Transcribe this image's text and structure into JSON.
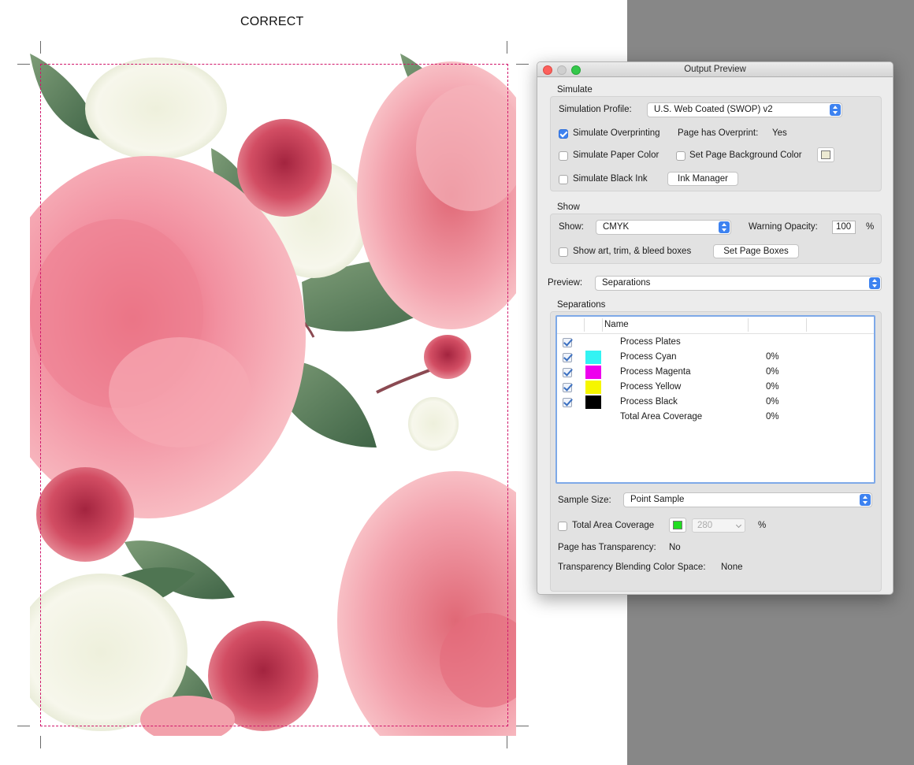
{
  "document": {
    "caption": "CORRECT"
  },
  "dialog": {
    "title": "Output Preview",
    "simulate": {
      "section_label": "Simulate",
      "profile_label": "Simulation Profile:",
      "profile_value": "U.S. Web Coated (SWOP) v2",
      "overprinting_label": "Simulate Overprinting",
      "overprinting_checked": true,
      "page_overprint_label": "Page has Overprint:",
      "page_overprint_value": "Yes",
      "paper_color_label": "Simulate Paper Color",
      "paper_color_checked": false,
      "page_bg_label": "Set Page Background Color",
      "page_bg_checked": false,
      "page_bg_color": "#ece9d2",
      "black_ink_label": "Simulate Black Ink",
      "black_ink_checked": false,
      "ink_manager_label": "Ink Manager"
    },
    "show": {
      "section_label": "Show",
      "show_label": "Show:",
      "show_value": "CMYK",
      "warning_opacity_label": "Warning Opacity:",
      "warning_opacity_value": "100",
      "warning_opacity_unit": "%",
      "boxes_label": "Show art, trim, & bleed boxes",
      "boxes_checked": false,
      "set_page_boxes_label": "Set Page Boxes"
    },
    "preview": {
      "label": "Preview:",
      "value": "Separations"
    },
    "separations": {
      "section_label": "Separations",
      "column_name": "Name",
      "rows": [
        {
          "name": "Process Plates",
          "coverage": "",
          "checked": true,
          "color": ""
        },
        {
          "name": "Process Cyan",
          "coverage": "0%",
          "checked": true,
          "color": "#33f3f3"
        },
        {
          "name": "Process Magenta",
          "coverage": "0%",
          "checked": true,
          "color": "#ee00ee"
        },
        {
          "name": "Process Yellow",
          "coverage": "0%",
          "checked": true,
          "color": "#f6f600"
        },
        {
          "name": "Process Black",
          "coverage": "0%",
          "checked": true,
          "color": "#000000"
        },
        {
          "name": "Total Area Coverage",
          "coverage": "0%",
          "checked": false,
          "color": ""
        }
      ]
    },
    "sample_size": {
      "label": "Sample Size:",
      "value": "Point Sample"
    },
    "total_area": {
      "label": "Total Area Coverage",
      "checked": false,
      "color": "#22dd22",
      "value": "280",
      "unit": "%"
    },
    "transparency": {
      "label": "Page has Transparency:",
      "value": "No",
      "blending_label": "Transparency Blending Color Space:",
      "blending_value": "None"
    }
  }
}
